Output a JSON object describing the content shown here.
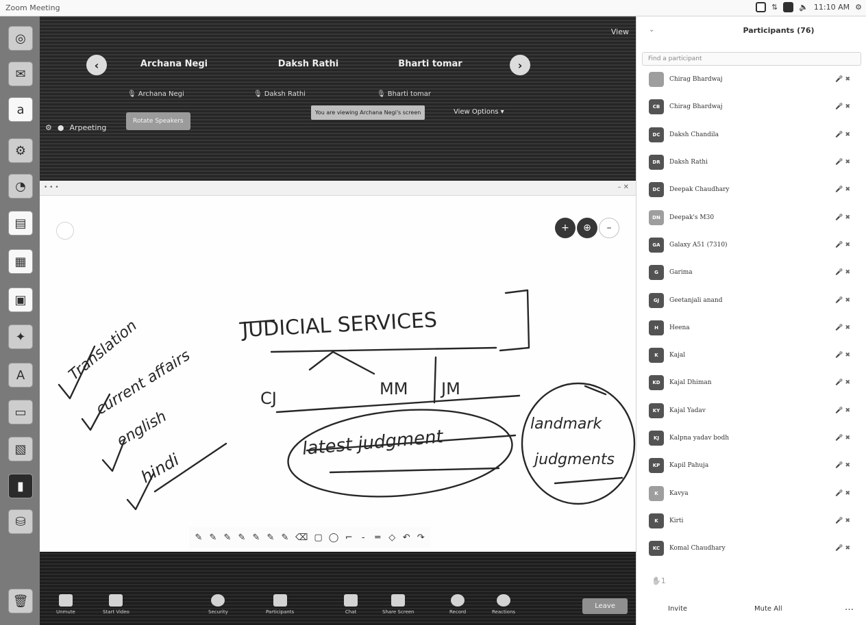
{
  "window": {
    "title": "Zoom Meeting"
  },
  "system": {
    "clock": "11:10 AM"
  },
  "launcher": {
    "apps": [
      "dash-icon",
      "files-icon",
      "amazon-icon",
      "settings-icon",
      "software-icon",
      "writer-icon",
      "calc-icon",
      "impress-icon",
      "tools-icon",
      "text-icon",
      "monitor-icon",
      "viewer-icon",
      "terminal-icon",
      "drive-icon",
      "trash-icon"
    ]
  },
  "gallery": {
    "view_label": "View",
    "participants": [
      "Archana Negi",
      "Daksh Rathi",
      "Bharti tomar"
    ],
    "tile_labels": [
      "Archana Negi",
      "Daksh Rathi",
      "Bharti tomar"
    ],
    "muted_line": "Arpeeting",
    "button_label": "Rotate Speakers",
    "banner": "You are viewing Archana Negi's screen",
    "view_options": "View Options ▾"
  },
  "whiteboard": {
    "toolbar_items": [
      "✎",
      "✎",
      "✎",
      "✎",
      "✎",
      "✎",
      "✎",
      "⌫",
      "▢",
      "◯",
      "⌐",
      "‐",
      "═",
      "◇",
      "↶",
      "↷"
    ],
    "handwriting": {
      "heading": "JUDICIAL SERVICES",
      "branch_1": "CJ",
      "branch_2": "MM",
      "branch_3": "JM",
      "left_1": "Translation",
      "left_2": "current affairs",
      "left_3": "english",
      "left_4": "hindi",
      "bottom_1": "latest judgment",
      "bottom_2": "landmark",
      "bottom_3": "judgments"
    }
  },
  "meeting_toolbar": {
    "items": [
      "Unmute",
      "Start Video",
      "Security",
      "Participants",
      "Chat",
      "Share Screen",
      "Record",
      "Reactions"
    ],
    "leave_label": "Leave"
  },
  "participants_panel": {
    "title": "Participants (76)",
    "search_placeholder": "Find a participant",
    "list": [
      {
        "initials": "",
        "name": "Chirag Bhardwaj",
        "status": "🎤 ✖"
      },
      {
        "initials": "CB",
        "name": "Chirag Bhardwaj",
        "status": "🎤 ✖"
      },
      {
        "initials": "DC",
        "name": "Daksh Chandila",
        "status": "🎤 ✖"
      },
      {
        "initials": "DR",
        "name": "Daksh Rathi",
        "status": "🎤 ✖"
      },
      {
        "initials": "DC",
        "name": "Deepak Chaudhary",
        "status": "🎤 ✖"
      },
      {
        "initials": "DN",
        "name": "Deepak's M30",
        "status": "🎤 ✖"
      },
      {
        "initials": "GA",
        "name": "Galaxy A51 (7310)",
        "status": "🎤 ✖"
      },
      {
        "initials": "G",
        "name": "Garima",
        "status": "🎤 ✖"
      },
      {
        "initials": "GJ",
        "name": "Geetanjali anand",
        "status": "🎤 ✖"
      },
      {
        "initials": "H",
        "name": "Heena",
        "status": "🎤 ✖"
      },
      {
        "initials": "K",
        "name": "Kajal",
        "status": "🎤 ✖"
      },
      {
        "initials": "KD",
        "name": "Kajal Dhiman",
        "status": "🎤 ✖"
      },
      {
        "initials": "KY",
        "name": "Kajal Yadav",
        "status": "🎤 ✖"
      },
      {
        "initials": "KJ",
        "name": "Kalpna yadav bodh",
        "status": "🎤 ✖"
      },
      {
        "initials": "KP",
        "name": "Kapil Pahuja",
        "status": "🎤 ✖"
      },
      {
        "initials": "K",
        "name": "Kavya",
        "status": "🎤 ✖"
      },
      {
        "initials": "K",
        "name": "Kirti",
        "status": "🎤 ✖"
      },
      {
        "initials": "KC",
        "name": "Komal Chaudhary",
        "status": "🎤 ✖"
      }
    ],
    "hand_count": "✋1",
    "invite_label": "Invite",
    "mute_all_label": "Mute All",
    "more_label": "…"
  }
}
